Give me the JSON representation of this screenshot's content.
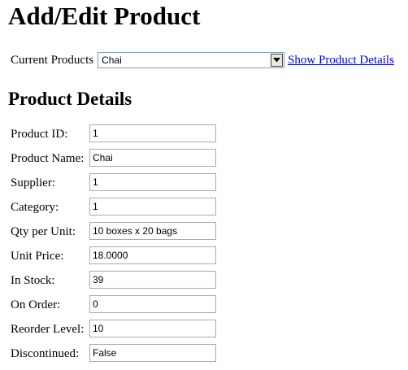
{
  "page": {
    "title": "Add/Edit Product"
  },
  "selector": {
    "label": "Current Products",
    "selected": "Chai",
    "show_link": "Show Product Details"
  },
  "details": {
    "heading": "Product Details",
    "fields": [
      {
        "label": "Product ID:",
        "value": "1"
      },
      {
        "label": "Product Name:",
        "value": "Chai"
      },
      {
        "label": "Supplier:",
        "value": "1"
      },
      {
        "label": "Category:",
        "value": "1"
      },
      {
        "label": "Qty per Unit:",
        "value": "10 boxes x 20 bags"
      },
      {
        "label": "Unit Price:",
        "value": "18.0000"
      },
      {
        "label": "In Stock:",
        "value": "39"
      },
      {
        "label": "On Order:",
        "value": "0"
      },
      {
        "label": "Reorder Level:",
        "value": "10"
      },
      {
        "label": "Discontinued:",
        "value": "False"
      }
    ]
  }
}
